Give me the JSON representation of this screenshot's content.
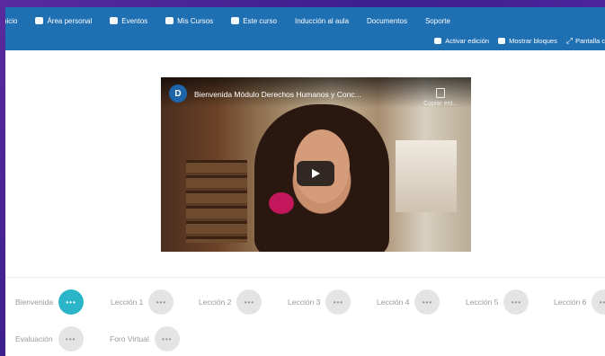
{
  "nav": {
    "row1": [
      {
        "label": "nicio",
        "icon": "home-icon"
      },
      {
        "label": "Área personal",
        "icon": "dashboard-icon"
      },
      {
        "label": "Eventos",
        "icon": "calendar-icon"
      },
      {
        "label": "Mis Cursos",
        "icon": "briefcase-icon"
      },
      {
        "label": "Este curso",
        "icon": "sitemap-icon"
      },
      {
        "label": "Inducción al aula",
        "icon": null
      },
      {
        "label": "Documentos",
        "icon": null
      },
      {
        "label": "Soporte",
        "icon": null
      }
    ],
    "row2": [
      {
        "label": "Activar edición",
        "icon": "pencil-icon"
      },
      {
        "label": "Mostrar bloques",
        "icon": "blocks-icon"
      },
      {
        "label": "Pantalla c",
        "icon": "expand-icon"
      }
    ]
  },
  "video": {
    "channel_letter": "D",
    "title": "Bienvenida Módulo Derechos Humanos y Conc...",
    "copy_link_label": "Copiar enl..."
  },
  "lessons": {
    "row1": [
      {
        "label": "Bienvenida",
        "active": true
      },
      {
        "label": "Lección 1",
        "active": false
      },
      {
        "label": "Lección 2",
        "active": false
      },
      {
        "label": "Lección 3",
        "active": false
      },
      {
        "label": "Lección 4",
        "active": false
      },
      {
        "label": "Lección 5",
        "active": false
      },
      {
        "label": "Lección 6",
        "active": false
      }
    ],
    "row2": [
      {
        "label": "Evaluación",
        "active": false
      },
      {
        "label": "Foro Virtual",
        "active": false
      }
    ],
    "dot_text": "•••"
  },
  "colors": {
    "navbar": "#1f6fb3",
    "active": "#2bb5c9",
    "inactive": "#e4e4e4"
  }
}
